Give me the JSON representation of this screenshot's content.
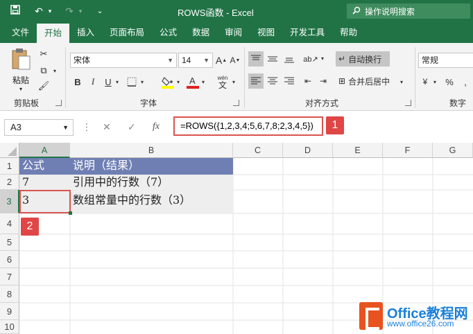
{
  "window": {
    "title": "ROWS函数  -  Excel"
  },
  "search": {
    "placeholder": "操作说明搜索"
  },
  "tabs": [
    "文件",
    "开始",
    "插入",
    "页面布局",
    "公式",
    "数据",
    "审阅",
    "视图",
    "开发工具",
    "帮助"
  ],
  "ribbon": {
    "clipboard": {
      "paste_label": "粘贴",
      "group_label": "剪贴板"
    },
    "font": {
      "name": "宋体",
      "size": "14",
      "group_label": "字体",
      "bold": "B",
      "italic": "I",
      "underline": "U",
      "wen": "wén"
    },
    "alignment": {
      "wrap_label": "自动换行",
      "merge_label": "合并后居中",
      "group_label": "对齐方式"
    },
    "number": {
      "format": "常规",
      "group_label": "数字",
      "percent": "%"
    }
  },
  "formula_bar": {
    "name_box": "A3",
    "formula": "=ROWS({1,2,3,4;5,6,7,8;2,3,4,5})",
    "fx": "fx"
  },
  "badges": {
    "one": "1",
    "two": "2"
  },
  "sheet": {
    "columns": [
      "A",
      "B",
      "C",
      "D",
      "E",
      "F",
      "G"
    ],
    "rows": [
      "1",
      "2",
      "3",
      "4",
      "5",
      "6",
      "7",
      "8",
      "9",
      "10"
    ],
    "cells": {
      "a1": "公式",
      "b1": "说明（结果）",
      "a2": "7",
      "b2": "引用中的行数（7）",
      "a3": "3",
      "b3": "数组常量中的行数（3）"
    }
  },
  "watermark": {
    "name": "Office教程网",
    "url": "www.office26.com"
  }
}
